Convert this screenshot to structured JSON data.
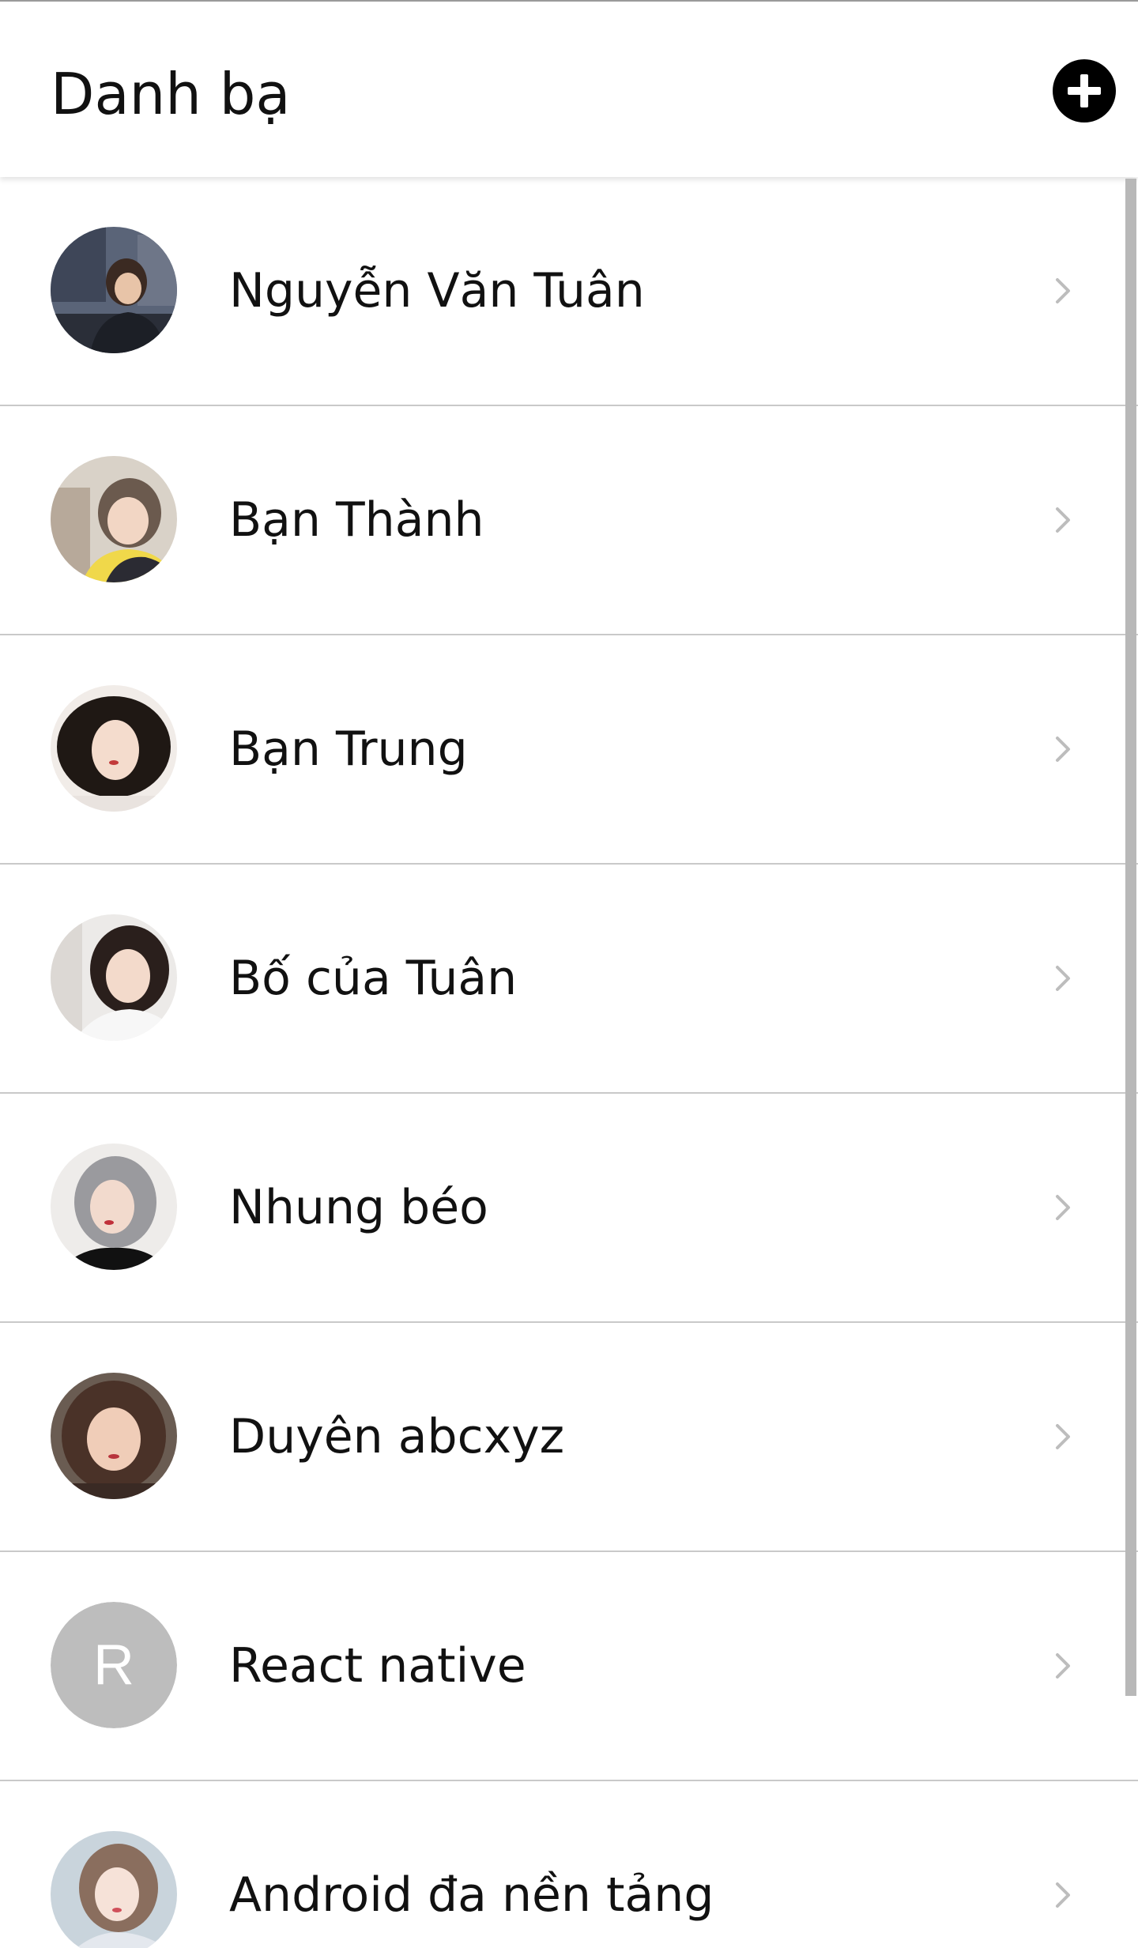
{
  "header": {
    "title": "Danh bạ",
    "add_icon": "plus-circle-icon"
  },
  "contacts": [
    {
      "name": "Nguyễn Văn Tuân",
      "avatar": "photo"
    },
    {
      "name": "Bạn Thành",
      "avatar": "photo"
    },
    {
      "name": "Bạn Trung",
      "avatar": "photo"
    },
    {
      "name": "Bố của Tuân",
      "avatar": "photo"
    },
    {
      "name": "Nhung béo",
      "avatar": "photo"
    },
    {
      "name": "Duyên abcxyz",
      "avatar": "photo"
    },
    {
      "name": "React native",
      "avatar": "letter",
      "initial": "R"
    },
    {
      "name": "Android đa nền tảng",
      "avatar": "photo"
    }
  ],
  "row_icon": "chevron-right-icon",
  "colors": {
    "accent": "#000000",
    "divider": "#c9c9c9",
    "letter_avatar_bg": "#bdbdbd",
    "chevron": "#bdbdbd"
  }
}
